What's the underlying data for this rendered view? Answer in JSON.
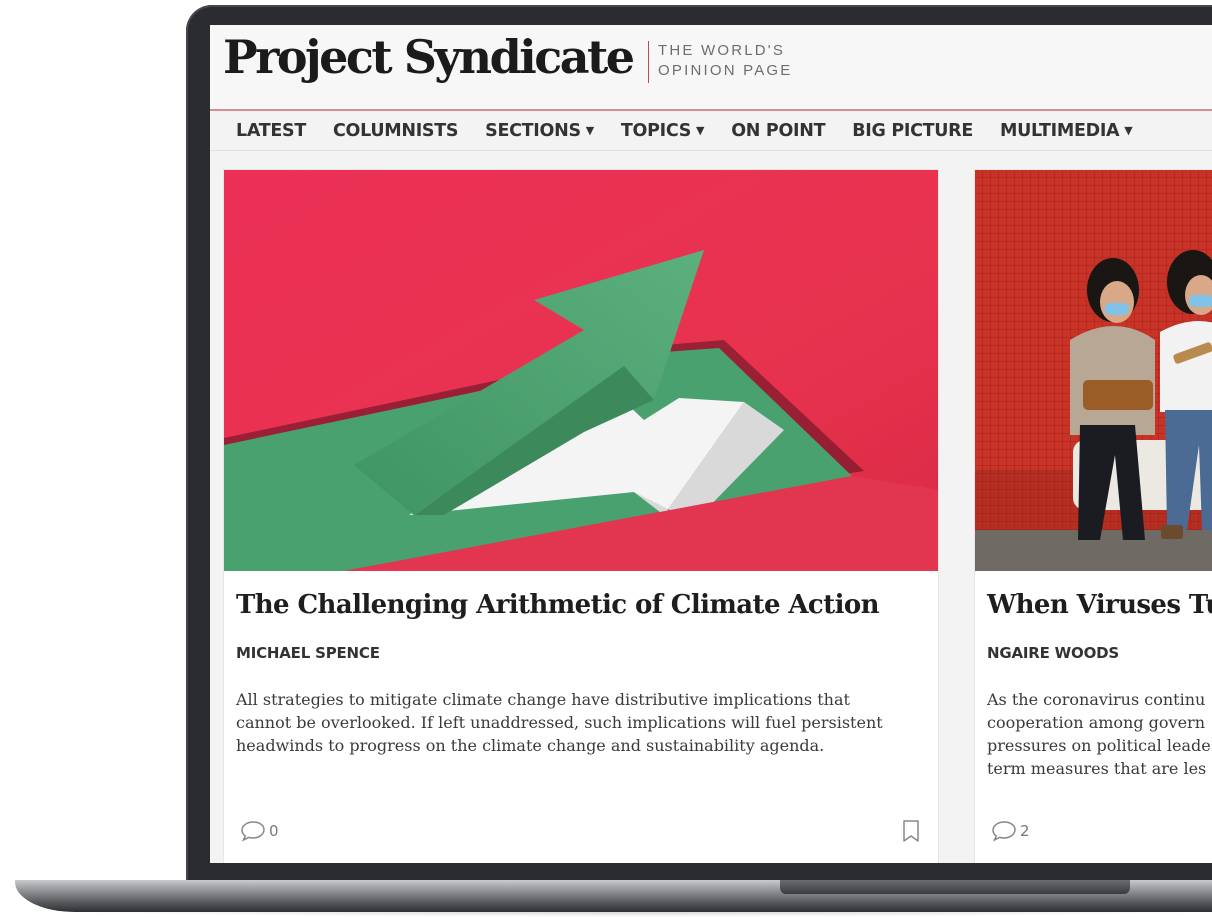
{
  "header": {
    "logo": "Project Syndicate",
    "tagline_line1": "THE WORLD'S",
    "tagline_line2": "OPINION PAGE"
  },
  "nav": {
    "items": [
      {
        "label": "LATEST"
      },
      {
        "label": "COLUMNISTS"
      },
      {
        "label": "SECTIONS",
        "dropdown": true
      },
      {
        "label": "TOPICS",
        "dropdown": true
      },
      {
        "label": "ON POINT"
      },
      {
        "label": "BIG PICTURE"
      },
      {
        "label": "MULTIMEDIA",
        "dropdown": true
      }
    ],
    "caret": "▼"
  },
  "articles": [
    {
      "title": "The Challenging Arithmetic of Climate Action",
      "author": "MICHAEL SPENCE",
      "excerpt": "All strategies to mitigate climate change have distributive implications that\ncannot be overlooked. If left unaddressed, such implications will fuel persistent\nheadwinds to progress on the climate change and sustainability agenda.",
      "comments": "0",
      "image_icon": "green-arrow-illustration"
    },
    {
      "title": "When Viruses Tu",
      "author": "NGAIRE WOODS",
      "excerpt": "As the coronavirus continu\ncooperation among govern\npressures on political leade\nterm measures that are les",
      "comments": "2",
      "image_icon": "masked-women-photo"
    }
  ],
  "colors": {
    "accent": "#c14a58",
    "card_red": "#e8334f",
    "arrow_green": "#4fa773"
  }
}
